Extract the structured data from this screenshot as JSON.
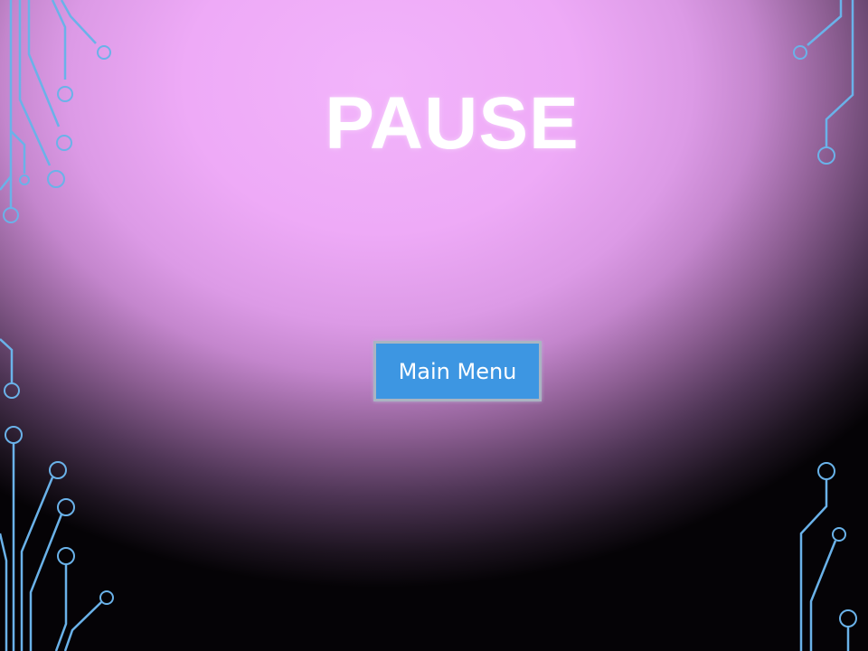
{
  "screen": {
    "title": "PAUSE",
    "menu": {
      "main_menu_label": "Main Menu"
    }
  },
  "theme": {
    "background_light": "#f2b4fb",
    "background_dark": "#050306",
    "circuit_color": "#6ab2e9",
    "button_color": "#3d96e2",
    "title_color": "#ffffff"
  }
}
